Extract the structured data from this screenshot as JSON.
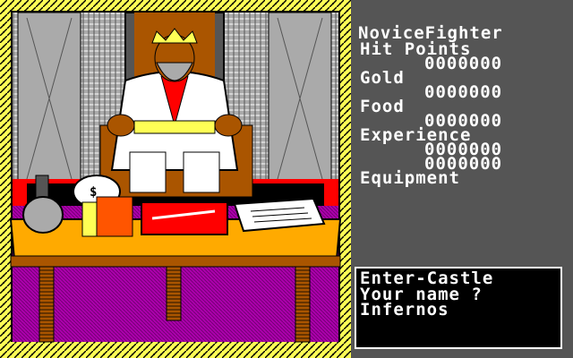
{
  "character": {
    "title": "NoviceFighter"
  },
  "stats": [
    {
      "label": "Hit Points",
      "value": "0000000"
    },
    {
      "label": "Gold",
      "value": "0000000"
    },
    {
      "label": "Food",
      "value": "0000000"
    },
    {
      "label": "Experience",
      "value": "0000000"
    },
    {
      "label": "",
      "value": "0000000"
    },
    {
      "label": "Equipment",
      "value": ""
    }
  ],
  "console": {
    "lines": [
      "Enter-Castle",
      "Your name ?",
      "Infernos"
    ]
  },
  "colors": {
    "border_yellow": "#ffff55",
    "carpet_red": "#ff0000",
    "floor_purple": "#aa00aa",
    "table_orange": "#ffaa00",
    "panel_gray": "#555555"
  }
}
